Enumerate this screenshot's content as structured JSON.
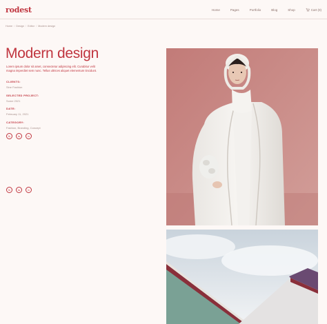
{
  "header": {
    "logo": "rodest",
    "nav": [
      "Home",
      "Pages",
      "Portfolio",
      "Blog",
      "Shop"
    ],
    "cart_label": "Cart (0)"
  },
  "breadcrumb": [
    "Home",
    "Design",
    "Editor",
    "Modern design"
  ],
  "project": {
    "title": "Modern design",
    "description": "Lorem ipsum dolor sit amet, consectetur adipiscing elit. Curabitur velit magna imperdiet sem nunc. Tellus ultrices aliquet elementum tincidunt.",
    "meta": [
      {
        "label": "CLIENTS:",
        "value": "Sine Fashion"
      },
      {
        "label": "SELECTED PROJECT:",
        "value": "Some 2021"
      },
      {
        "label": "DATE:",
        "value": "February 11, 2021"
      },
      {
        "label": "CATEGORY:",
        "value": "Fashion, Branding, Concept"
      }
    ],
    "social": [
      "fb",
      "tw",
      "in"
    ]
  },
  "colors": {
    "accent": "#c0353f",
    "background": "#fdf8f6",
    "muted": "#a78f8b"
  }
}
